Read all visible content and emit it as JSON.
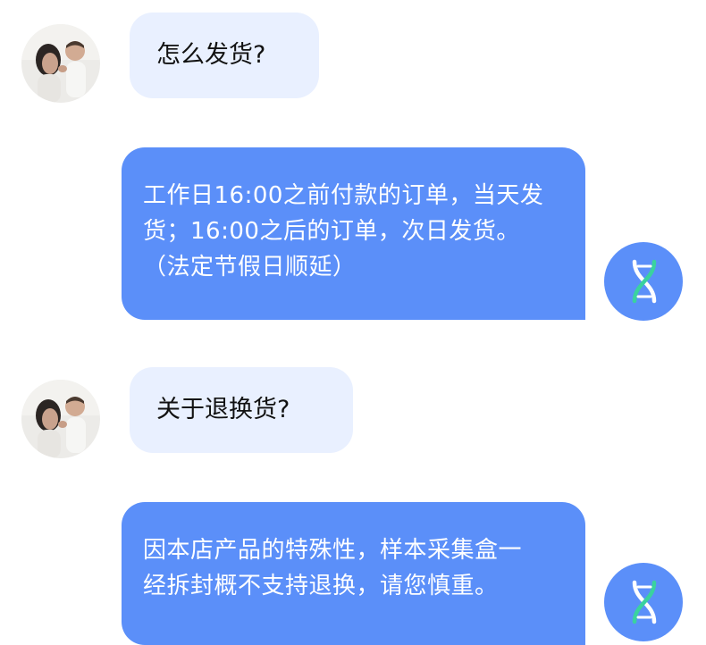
{
  "messages": [
    {
      "role": "user",
      "text": "怎么发货?"
    },
    {
      "role": "bot",
      "lines": [
        "工作日16:00之前付款的订单，当天发",
        "货；16:00之后的订单，次日发货。",
        "（法定节假日顺延）"
      ]
    },
    {
      "role": "user",
      "text": "关于退换货?"
    },
    {
      "role": "bot",
      "lines": [
        "因本店产品的特殊性，样本采集盒一",
        "经拆封概不支持退换，请您慎重。"
      ]
    }
  ],
  "icons": {
    "user_avatar": "user-photo-avatar",
    "bot_avatar": "dna-helix-icon"
  },
  "colors": {
    "user_bubble": "#e9f0ff",
    "bot_bubble": "#5b8ff9",
    "bot_text": "#ffffff",
    "dna_white": "#ffffff",
    "dna_green": "#3ad29f"
  }
}
